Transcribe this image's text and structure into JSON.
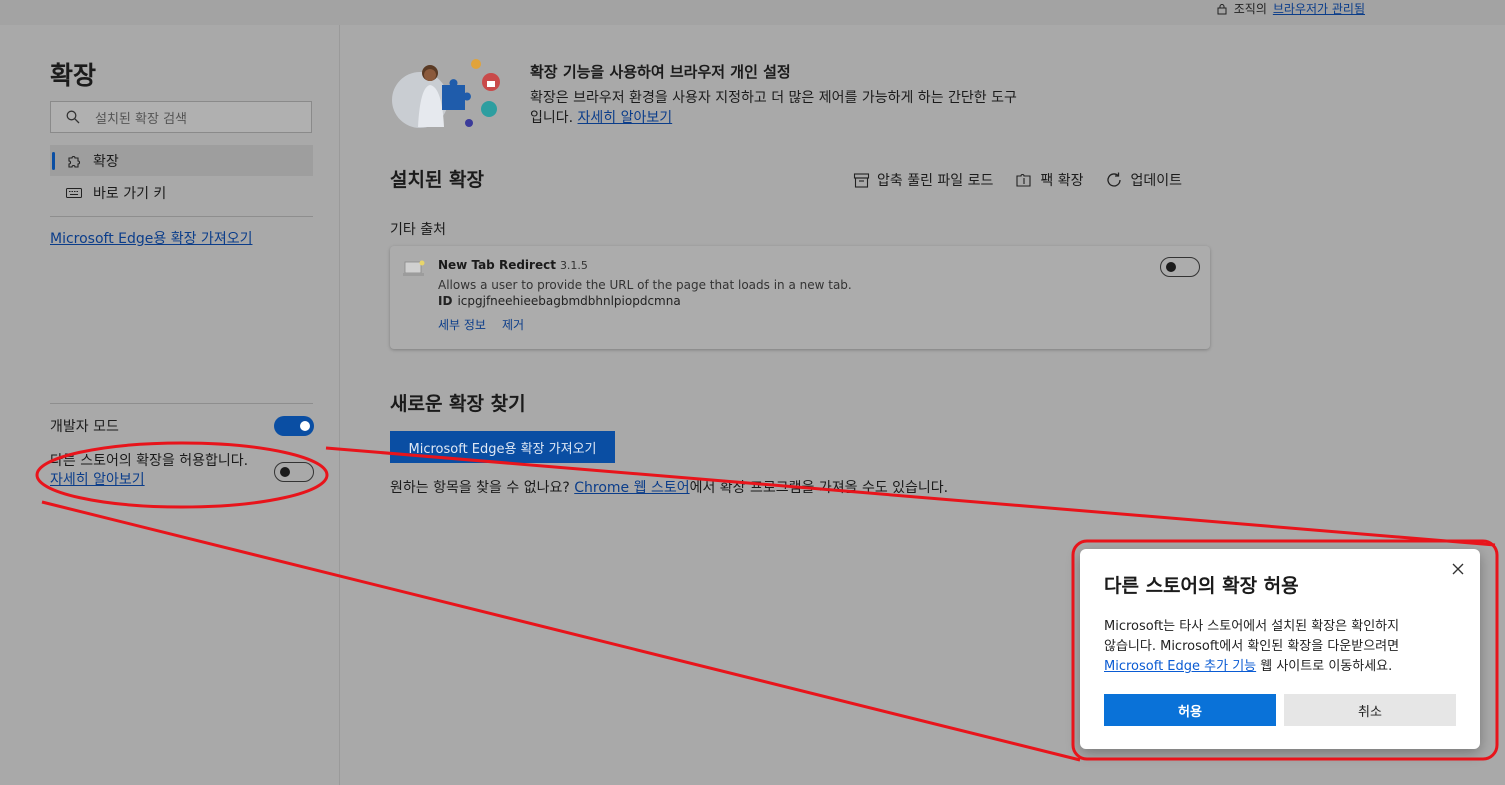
{
  "header": {
    "org_prefix": "조직의",
    "org_link": "브라우저가 관리됨"
  },
  "sidebar": {
    "title": "확장",
    "search_placeholder": "설치된 확장 검색",
    "items": [
      {
        "label": "확장",
        "icon": "puzzle-icon",
        "active": true
      },
      {
        "label": "바로 가기 키",
        "icon": "keyboard-icon",
        "active": false
      }
    ],
    "get_extensions_link": "Microsoft Edge용 확장 가져오기",
    "developer_mode": {
      "label": "개발자 모드",
      "enabled": true
    },
    "allow_other_stores": {
      "label": "다른 스토어의 확장을 허용합니다.",
      "learn_more": "자세히 알아보기",
      "enabled": false
    }
  },
  "main": {
    "hero": {
      "title": "확장 기능을 사용하여 브라우저 개인 설정",
      "desc": "확장은 브라우저 환경을 사용자 지정하고 더 많은 제어를 가능하게 하는 간단한 도구",
      "desc_line2": "입니다.",
      "learn_more": "자세히 알아보기"
    },
    "installed_title": "설치된 확장",
    "tools": [
      {
        "label": "압축 풀린 파일 로드",
        "icon": "load-unpacked-icon"
      },
      {
        "label": "팩 확장",
        "icon": "pack-extension-icon"
      },
      {
        "label": "업데이트",
        "icon": "refresh-icon"
      }
    ],
    "other_sources": "기타 출처",
    "extension": {
      "name": "New Tab Redirect",
      "version": "3.1.5",
      "description": "Allows a user to provide the URL of the page that loads in a new tab.",
      "id_label": "ID",
      "id_value": "icpgjfneehieebagbmdbhnlpiopdcmna",
      "details": "세부 정보",
      "remove": "제거",
      "enabled": false
    },
    "find_title": "새로운 확장 찾기",
    "get_button": "Microsoft Edge용 확장 가져오기",
    "cant_find_prefix": "원하는 항목을 찾을 수 없나요?",
    "cant_find_link": "Chrome 웹 스토어",
    "cant_find_suffix": "에서 확장 프로그램을 가져올 수도 있습니다."
  },
  "dialog": {
    "title": "다른 스토어의 확장 허용",
    "body_line1": "Microsoft는 타사 스토어에서 설치된 확장은 확인하지",
    "body_line2": "않습니다. Microsoft에서 확인된 확장을 다운받으려면",
    "body_link": "Microsoft Edge 추가 기능",
    "body_suffix": " 웹 사이트로 이동하세요.",
    "allow_button": "허용",
    "cancel_button": "취소"
  },
  "colors": {
    "accent": "#0a4ea3",
    "annotation": "#e8141b",
    "dialog_primary": "#0a72d8"
  }
}
